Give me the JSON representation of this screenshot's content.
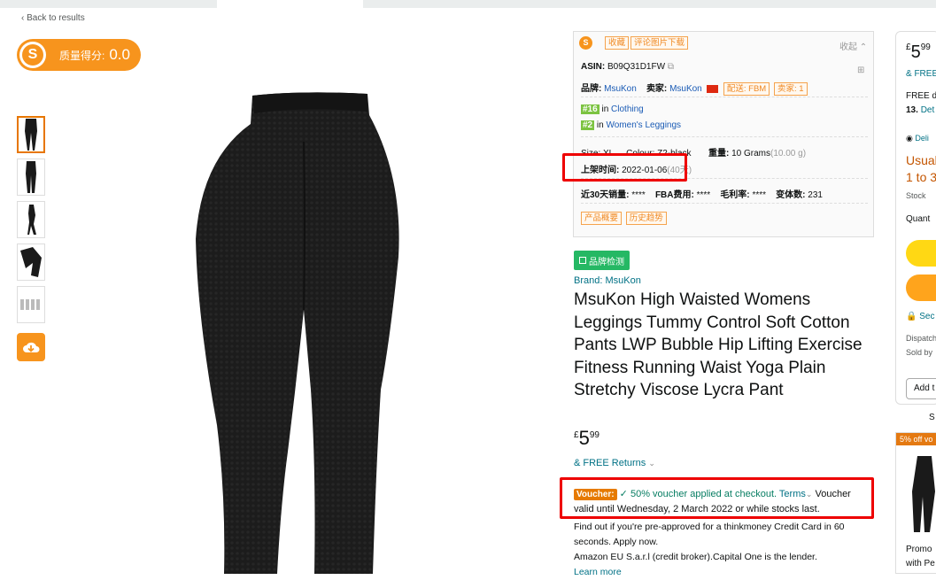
{
  "nav": {
    "back": "‹ Back to results"
  },
  "quality": {
    "label": "质量得分:",
    "value": "0.0"
  },
  "thumbs": [
    "leggings-back",
    "leggings-side",
    "leggings-pose",
    "leggings-crop",
    "size-chart"
  ],
  "panel": {
    "header": {
      "fav": "收藏",
      "reviews_img": "评论图片下载",
      "collapse": "收起"
    },
    "asin_label": "ASIN:",
    "asin": "B09Q31D1FW",
    "brand_label": "品牌:",
    "brand": "MsuKon",
    "seller_label": "卖家:",
    "seller": "MsuKon",
    "fulfil": "配送: FBM",
    "sellers": "卖家: 1",
    "ranks": [
      {
        "rank": "#16",
        "in": "in",
        "cat": "Clothing"
      },
      {
        "rank": "#2",
        "in": "in",
        "cat": "Women's Leggings"
      }
    ],
    "size": "Size: XL",
    "colour": "Colour: Z2-black",
    "weight_label": "重量:",
    "weight": "10 Grams",
    "weight_alt": "(10.00 g)",
    "listed_label": "上架时间:",
    "listed": "2022-01-06",
    "listed_days": "(40天)",
    "sales_label": "近30天销量:",
    "sales": "****",
    "fba_label": "FBA费用:",
    "fba": "****",
    "margin_label": "毛利率:",
    "margin": "****",
    "variants_label": "变体数:",
    "variants": "231",
    "btn_overview": "产品概要",
    "btn_history": "历史趋势"
  },
  "brand_check": "品牌检测",
  "brand_link": "Brand: MsuKon",
  "title": "MsuKon High Waisted Womens Leggings Tummy Control Soft Cotton Pants LWP Bubble Hip Lifting Exercise Fitness Running Waist Yoga Plain Stretchy Viscose Lycra Pant",
  "price": {
    "symbol": "£",
    "whole": "5",
    "fraction": "99"
  },
  "returns": "& FREE Returns",
  "voucher": {
    "label": "Voucher:",
    "applied": "50% voucher applied at checkout.",
    "terms": "Terms",
    "rest": "Voucher valid until Wednesday, 2 March 2022 or while stocks last."
  },
  "credit": {
    "line1": "Find out if you're pre-approved for a thinkmoney Credit Card in 60 seconds. Apply now.",
    "line2": "Amazon EU S.a.r.l (credit broker).Capital One is the lender.",
    "learn": "Learn more"
  },
  "buybox": {
    "price_whole": "5",
    "price_frac": "99",
    "free": "& FREE",
    "free_d": "FREE d",
    "date": "13.",
    "det": "Det",
    "deliver": "Deli",
    "usually1": "Usual",
    "usually2": "1 to 3",
    "stock": "Stock",
    "qty": "Quant",
    "secure": "Sec",
    "dispatch": "Dispatch",
    "soldby": "Sold by",
    "add": "Add t"
  },
  "below_s": "S",
  "ad": {
    "badge": "5% off vo",
    "promo": "Promo",
    "with": "with Pe"
  },
  "colors": {
    "accent": "#f7941d",
    "link": "#007185",
    "highlight": "#e00000"
  }
}
